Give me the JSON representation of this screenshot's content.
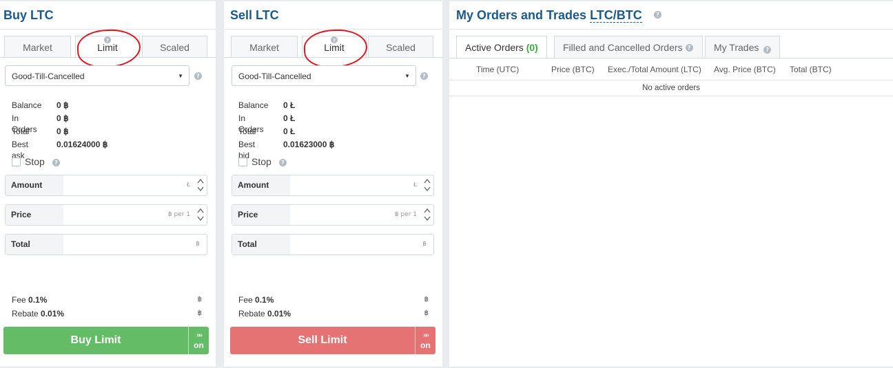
{
  "buy": {
    "title": "Buy LTC",
    "tabs": [
      "Market",
      "Limit",
      "Scaled"
    ],
    "order_type": "Good-Till-Cancelled",
    "info": [
      {
        "label": "Balance",
        "value": "0 ฿"
      },
      {
        "label": "In Orders",
        "value": "0 ฿"
      },
      {
        "label": "Total",
        "value": "0 ฿"
      },
      {
        "label": "Best ask",
        "value": "0.01624000 ฿"
      }
    ],
    "stop_label": "Stop",
    "amount_label": "Amount",
    "amount_unit": "Ł",
    "price_label": "Price",
    "price_unit": "฿ per 1",
    "total_label": "Total",
    "total_unit": "฿",
    "fee_label": "Fee",
    "fee_value": "0.1%",
    "rebate_label": "Rebate",
    "rebate_value": "0.01%",
    "fee_coin": "฿",
    "button_label": "Buy  Limit",
    "button_side": "on",
    "button_color": "#65bc67"
  },
  "sell": {
    "title": "Sell LTC",
    "tabs": [
      "Market",
      "Limit",
      "Scaled"
    ],
    "order_type": "Good-Till-Cancelled",
    "info": [
      {
        "label": "Balance",
        "value": "0 Ł"
      },
      {
        "label": "In Orders",
        "value": "0 Ł"
      },
      {
        "label": "Total",
        "value": "0 Ł"
      },
      {
        "label": "Best bid",
        "value": "0.01623000 ฿"
      }
    ],
    "stop_label": "Stop",
    "amount_label": "Amount",
    "amount_unit": "Ł",
    "price_label": "Price",
    "price_unit": "฿ per 1",
    "total_label": "Total",
    "total_unit": "฿",
    "fee_label": "Fee",
    "fee_value": "0.1%",
    "rebate_label": "Rebate",
    "rebate_value": "0.01%",
    "fee_coin": "฿",
    "button_label": "Sell  Limit",
    "button_side": "on",
    "button_color": "#e57373"
  },
  "orders": {
    "title": "My Orders and Trades",
    "pair": "LTC/BTC",
    "tabs": [
      {
        "label": "Active Orders",
        "count": "(0)"
      },
      {
        "label": "Filled and Cancelled Orders"
      },
      {
        "label": "My Trades"
      }
    ],
    "columns": [
      "Time (UTC)",
      "Price (BTC)",
      "Exec./Total Amount (LTC)",
      "Avg. Price (BTC)",
      "Total (BTC)"
    ],
    "empty_text": "No active orders"
  },
  "help_glyph": "?",
  "chevron_glyph": "»»"
}
